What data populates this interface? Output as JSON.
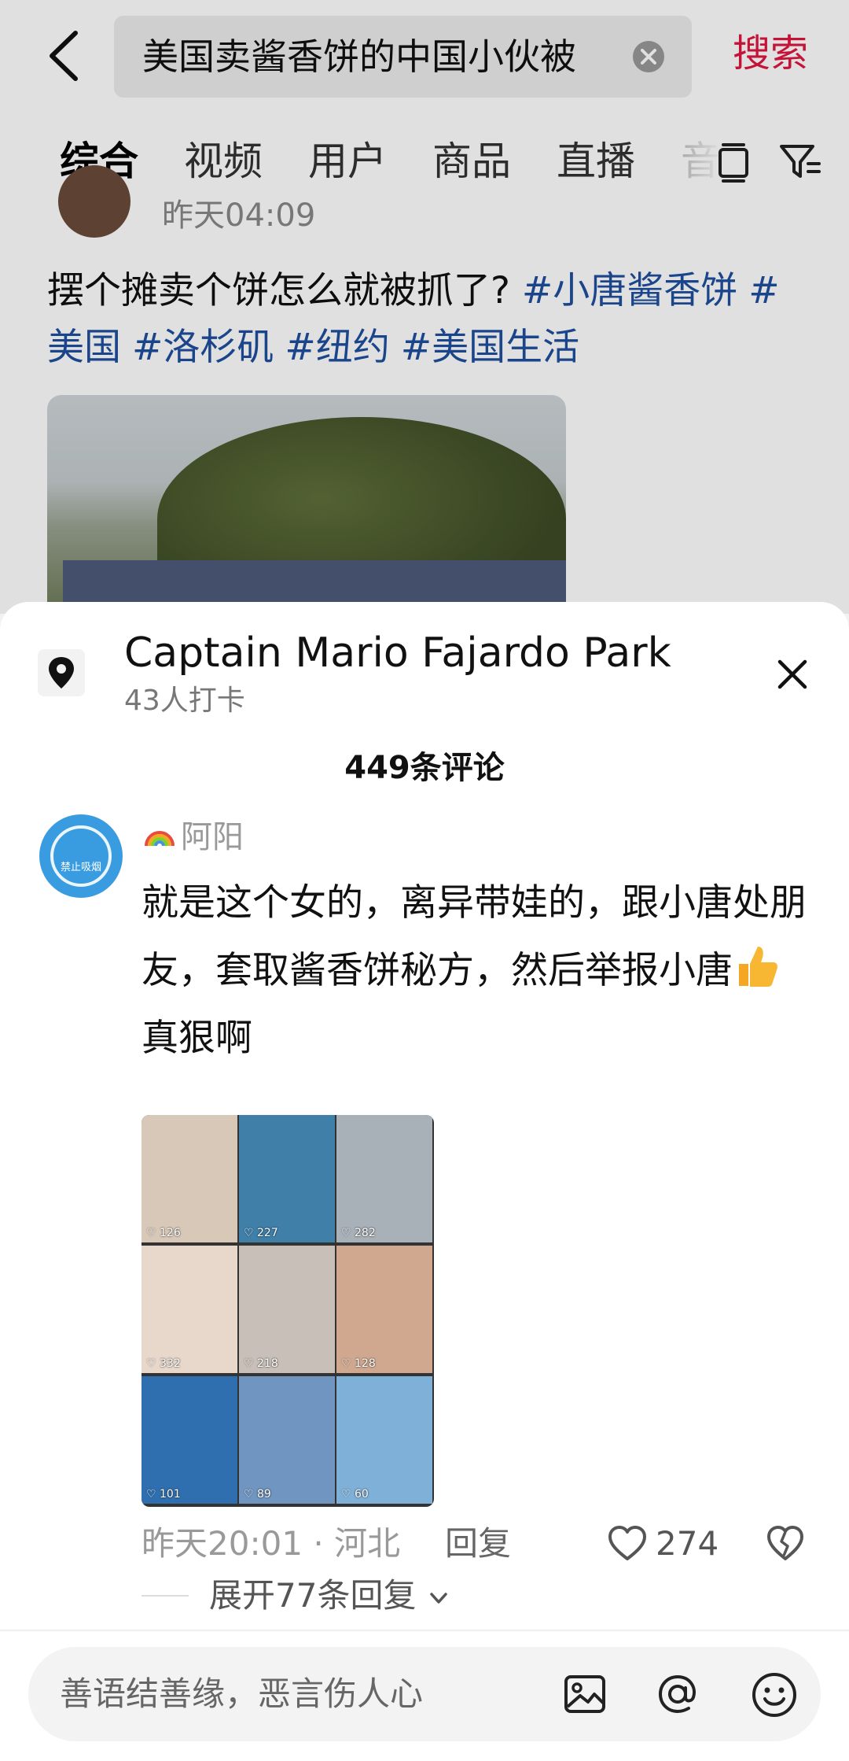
{
  "search": {
    "query": "美国卖酱香饼的中国小伙被",
    "search_label": "搜索"
  },
  "tabs": [
    {
      "label": "综合",
      "active": true
    },
    {
      "label": "视频"
    },
    {
      "label": "用户"
    },
    {
      "label": "商品"
    },
    {
      "label": "直播"
    },
    {
      "label": "音"
    }
  ],
  "post": {
    "time": "昨天04:09",
    "text": "摆个摊卖个饼怎么就被抓了?",
    "hashtags": [
      "#小唐酱香饼",
      "#美国",
      "#洛杉矶",
      "#纽约",
      "#美国生活"
    ]
  },
  "sheet": {
    "location_name": "Captain Mario Fajardo Park",
    "checkins": "43人打卡",
    "comment_count": "449条评论"
  },
  "comment": {
    "username": "阿阳",
    "avatar_text": "禁止吸烟",
    "text_part1": "就是这个女的，离异带娃的，跟小唐处朋友，套取酱香饼秘方，然后举报小唐",
    "text_part2": "真狠啊",
    "grid_likes": [
      "126",
      "227",
      "282",
      "332",
      "218",
      "128",
      "101",
      "89",
      "60"
    ],
    "grid_colors": [
      "#d8c8b8",
      "#3f7fa8",
      "#a8b0b8",
      "#e8d8cc",
      "#c8c0b8",
      "#d0a890",
      "#2f6fb0",
      "#6f95c0",
      "#7fb0d8"
    ],
    "time_location": "昨天20:01 · 河北",
    "reply_label": "回复",
    "likes": "274",
    "expand_label": "展开77条回复"
  },
  "input": {
    "placeholder": "善语结善缘，恶言伤人心"
  },
  "colors": {
    "accent": "#e0163f",
    "hashtag": "#1f4f9f"
  }
}
